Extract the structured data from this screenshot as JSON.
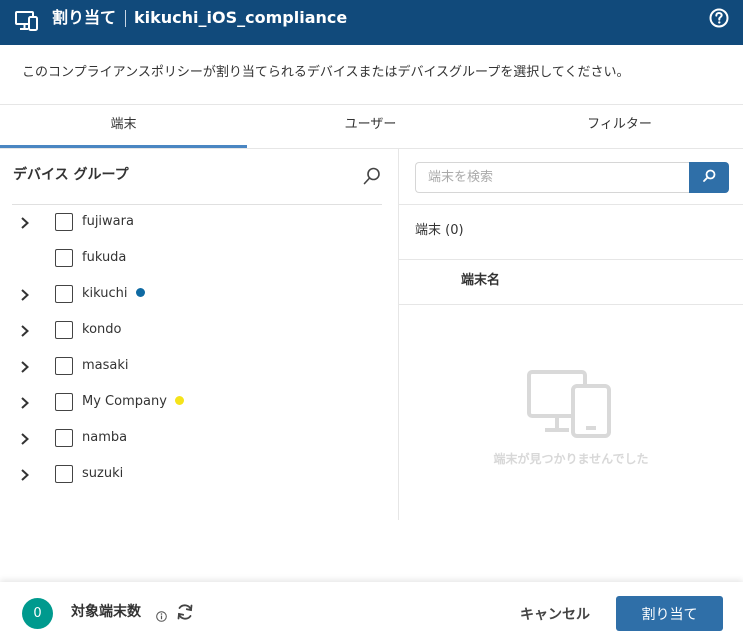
{
  "header": {
    "icon": "devices-icon",
    "title": "割り当て",
    "subtitle": "kikuchi_iOS_compliance",
    "help_icon": "help-circle-icon"
  },
  "description": "このコンプライアンスポリシーが割り当てられるデバイスまたはデバイスグループを選択してください。",
  "tabs": [
    {
      "label": "端末",
      "active": true
    },
    {
      "label": "ユーザー",
      "active": false
    },
    {
      "label": "フィルター",
      "active": false
    }
  ],
  "left_panel": {
    "title": "デバイス グループ",
    "search_icon": "search-icon",
    "groups": [
      {
        "label": "fujiwara",
        "expandable": true,
        "checked": false,
        "dot_color": ""
      },
      {
        "label": "fukuda",
        "expandable": false,
        "checked": false,
        "dot_color": ""
      },
      {
        "label": "kikuchi",
        "expandable": true,
        "checked": false,
        "dot_color": "#0f6aa3"
      },
      {
        "label": "kondo",
        "expandable": true,
        "checked": false,
        "dot_color": ""
      },
      {
        "label": "masaki",
        "expandable": true,
        "checked": false,
        "dot_color": ""
      },
      {
        "label": "My Company",
        "expandable": true,
        "checked": false,
        "dot_color": "#f5e31a"
      },
      {
        "label": "namba",
        "expandable": true,
        "checked": false,
        "dot_color": ""
      },
      {
        "label": "suzuki",
        "expandable": true,
        "checked": false,
        "dot_color": ""
      }
    ]
  },
  "right_panel": {
    "search_placeholder": "端末を検索",
    "search_value": "",
    "device_count_label": "端末 (0)",
    "column_header": "端末名",
    "empty_icon": "devices-empty-icon",
    "empty_text": "端末が見つかりませんでした"
  },
  "footer": {
    "count": "0",
    "label": "対象端末数",
    "info_icon": "info-icon",
    "refresh_icon": "refresh-icon",
    "cancel_label": "キャンセル",
    "assign_label": "割り当て"
  },
  "colors": {
    "header_bg": "#114a7b",
    "accent": "#2f6fa8",
    "tab_indicator": "#4a86c2",
    "badge": "#009a8e"
  }
}
